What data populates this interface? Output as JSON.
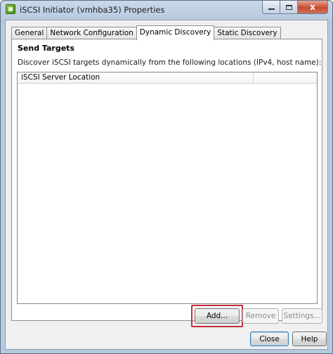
{
  "window": {
    "title": "iSCSI Initiator (vmhba35) Properties",
    "icon": "vsphere-app-icon",
    "controls": {
      "minimize": "minimize-icon",
      "maximize": "maximize-icon",
      "close": "x"
    }
  },
  "tabs": [
    {
      "label": "General",
      "active": false
    },
    {
      "label": "Network Configuration",
      "active": false
    },
    {
      "label": "Dynamic Discovery",
      "active": true
    },
    {
      "label": "Static Discovery",
      "active": false
    }
  ],
  "panel": {
    "section_title": "Send Targets",
    "description": "Discover iSCSI targets dynamically from the following locations (IPv4, host name):",
    "list": {
      "columns": [
        "iSCSI Server Location",
        ""
      ],
      "rows": []
    }
  },
  "actions": {
    "add_label": "Add...",
    "remove_label": "Remove",
    "settings_label": "Settings...",
    "highlight_color": "#c0303a"
  },
  "footer": {
    "close_label": "Close",
    "help_label": "Help"
  }
}
